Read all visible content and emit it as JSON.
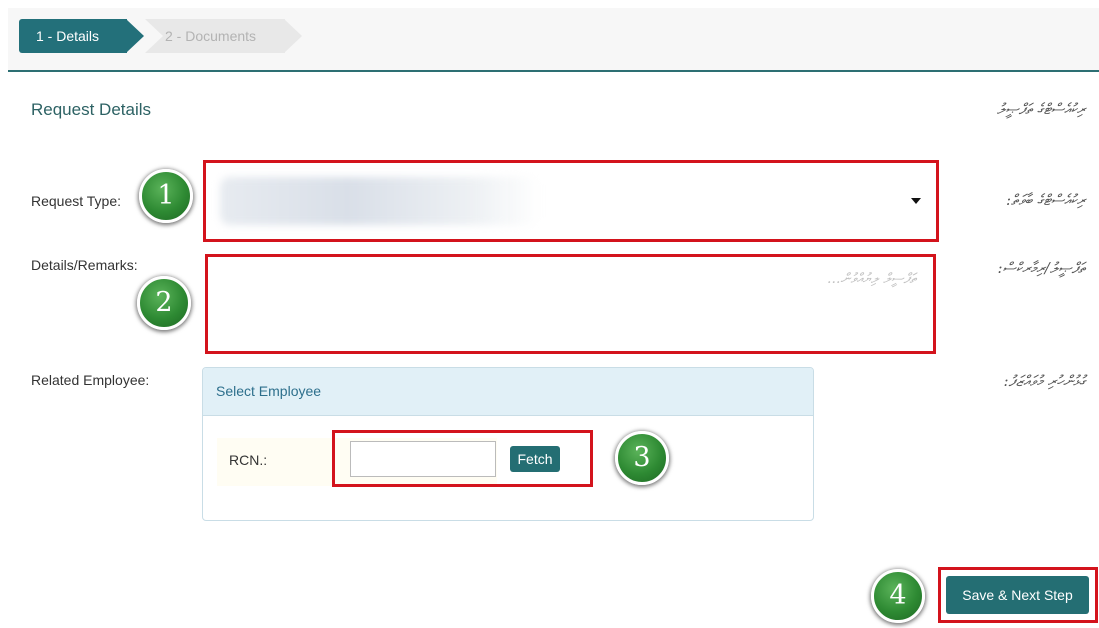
{
  "wizard": {
    "steps": [
      {
        "label": "1 - Details",
        "active": true
      },
      {
        "label": "2 - Documents",
        "active": false
      }
    ]
  },
  "section": {
    "title": "Request Details",
    "title_dv": "ރިކުއެސްޓްގެ ތަފްޞީލު"
  },
  "form": {
    "request_type": {
      "label": "Request Type:",
      "label_dv": "ރިކުއެސްޓްގެ ބާވަތް:"
    },
    "details": {
      "label": "Details/Remarks:",
      "label_dv": "ތަފްޞީލު/ރިމާރކްސް:",
      "placeholder": "ތަފްސީލް ލިޔުއްވުން..."
    },
    "related_employee": {
      "label": "Related Employee:",
      "label_dv": "ގުޅުންހުރި މުވައްޒަފު:"
    }
  },
  "employee_panel": {
    "title": "Select Employee",
    "rcn_label": "RCN.:",
    "rcn_value": "",
    "fetch_label": "Fetch"
  },
  "actions": {
    "save_next_label": "Save & Next Step"
  },
  "annotations": [
    "1",
    "2",
    "3",
    "4"
  ],
  "colors": {
    "accent": "#246e73",
    "highlight": "#d3131c",
    "badge": "#2e8a33"
  }
}
